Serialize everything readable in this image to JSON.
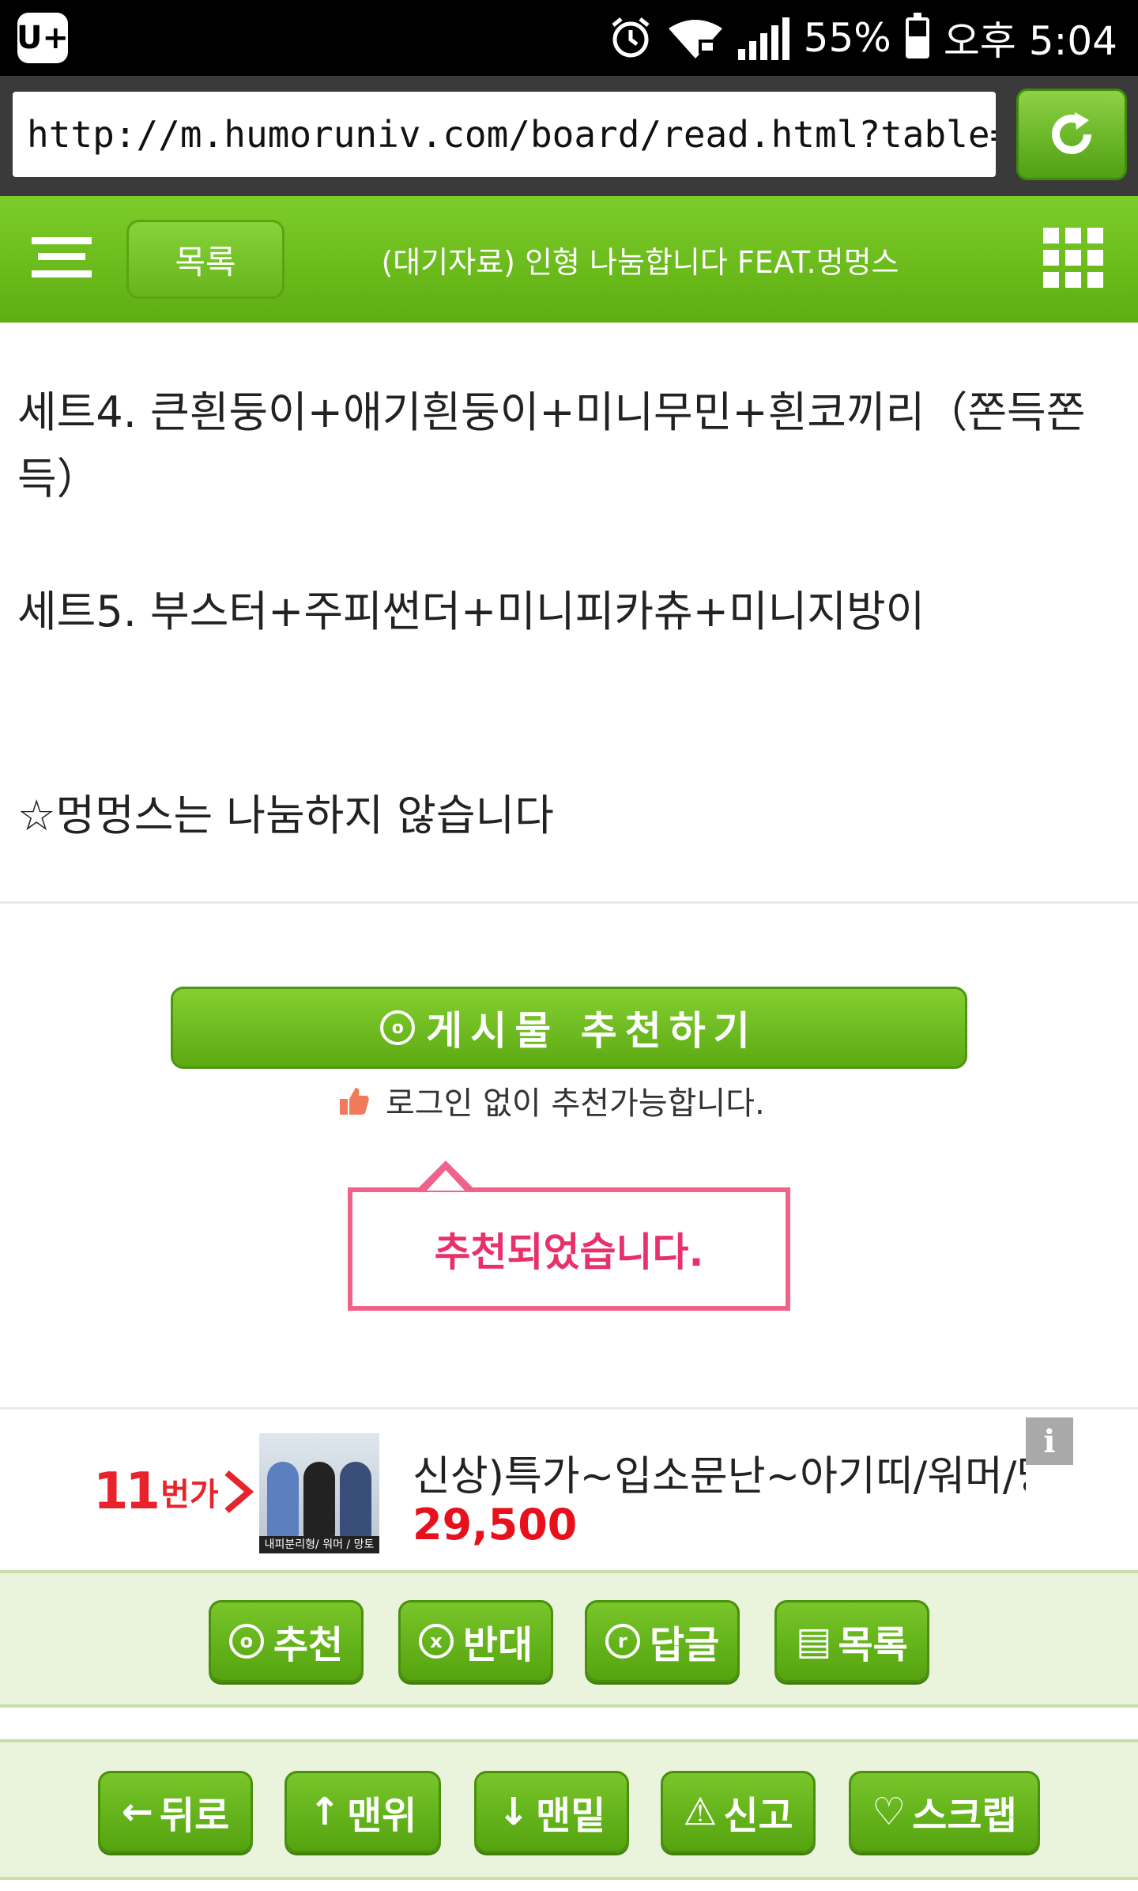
{
  "status_bar": {
    "carrier_logo": "U+",
    "battery": "55%",
    "battery_level": 0.55,
    "time": "오후 5:04"
  },
  "browser": {
    "url": "http://m.humoruniv.com/board/read.html?table=pds"
  },
  "header": {
    "list_label": "목록",
    "title": "(대기자료) 인형 나눔합니다 FEAT.멍멍스"
  },
  "article": {
    "lines": [
      "세트4. 큰흰둥이+애기흰둥이+미니무민+흰코끼리（쫀득쫀",
      "득）",
      "세트5. 부스터+주피썬더+미니피카츄+미니지방이",
      "☆멍멍스는 나눔하지 않습니다"
    ]
  },
  "recommend": {
    "button_icon": "o",
    "button_label": "게시물  추천하기",
    "note": "로그인 없이 추천가능합니다.",
    "toast": "추천되었습니다."
  },
  "ad": {
    "logo_number": "11",
    "logo_text": "번가",
    "thumb_caption": "내피분리형/ 워머 / 망토",
    "title": "신상)특가~입소문난~아기띠/워머/망토",
    "price": "29,500",
    "info_icon": "i"
  },
  "actions_top": [
    {
      "icon": "o",
      "label": "추천"
    },
    {
      "icon": "x",
      "label": "반대"
    },
    {
      "icon": "r",
      "label": "답글"
    },
    {
      "icon": "▤",
      "label": "목록"
    }
  ],
  "actions_bottom": [
    {
      "icon": "←",
      "label": "뒤로"
    },
    {
      "icon": "↑",
      "label": "맨위"
    },
    {
      "icon": "↓",
      "label": "맨밑"
    },
    {
      "icon": "⚠",
      "label": "신고"
    },
    {
      "icon": "♡",
      "label": "스크랩"
    }
  ]
}
